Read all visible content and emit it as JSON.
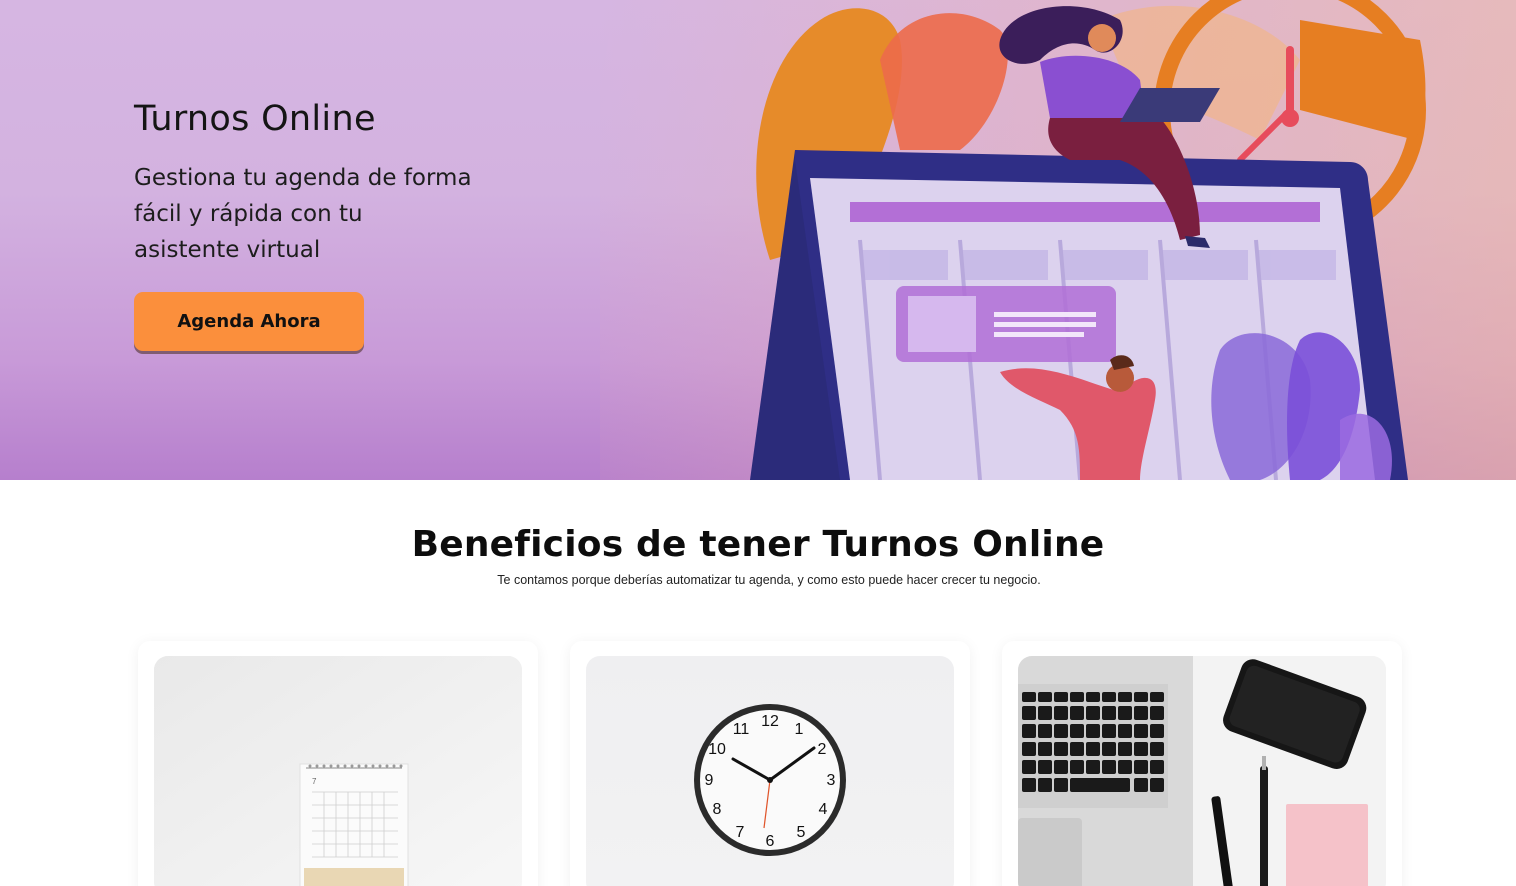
{
  "hero": {
    "title": "Turnos Online",
    "subtitle": "Gestiona tu agenda de forma fácil y rápida con tu asistente virtual",
    "cta_label": "Agenda Ahora",
    "cta_color": "#fb8f3c",
    "illustration": "person-with-laptop-on-calendar-screen-illustration"
  },
  "benefits": {
    "title": "Beneficios de tener Turnos Online",
    "subtitle": "Te contamos porque deberías automatizar tu agenda, y como esto puede hacer crecer tu negocio.",
    "cards": [
      {
        "image": "desk-calendar-photo"
      },
      {
        "image": "wall-clock-photo"
      },
      {
        "image": "laptop-phone-pens-photo"
      }
    ]
  },
  "clock": {
    "numbers": [
      "12",
      "1",
      "2",
      "3",
      "4",
      "5",
      "6",
      "7",
      "8",
      "9",
      "10",
      "11"
    ]
  },
  "calendar": {
    "month_number": "7"
  }
}
